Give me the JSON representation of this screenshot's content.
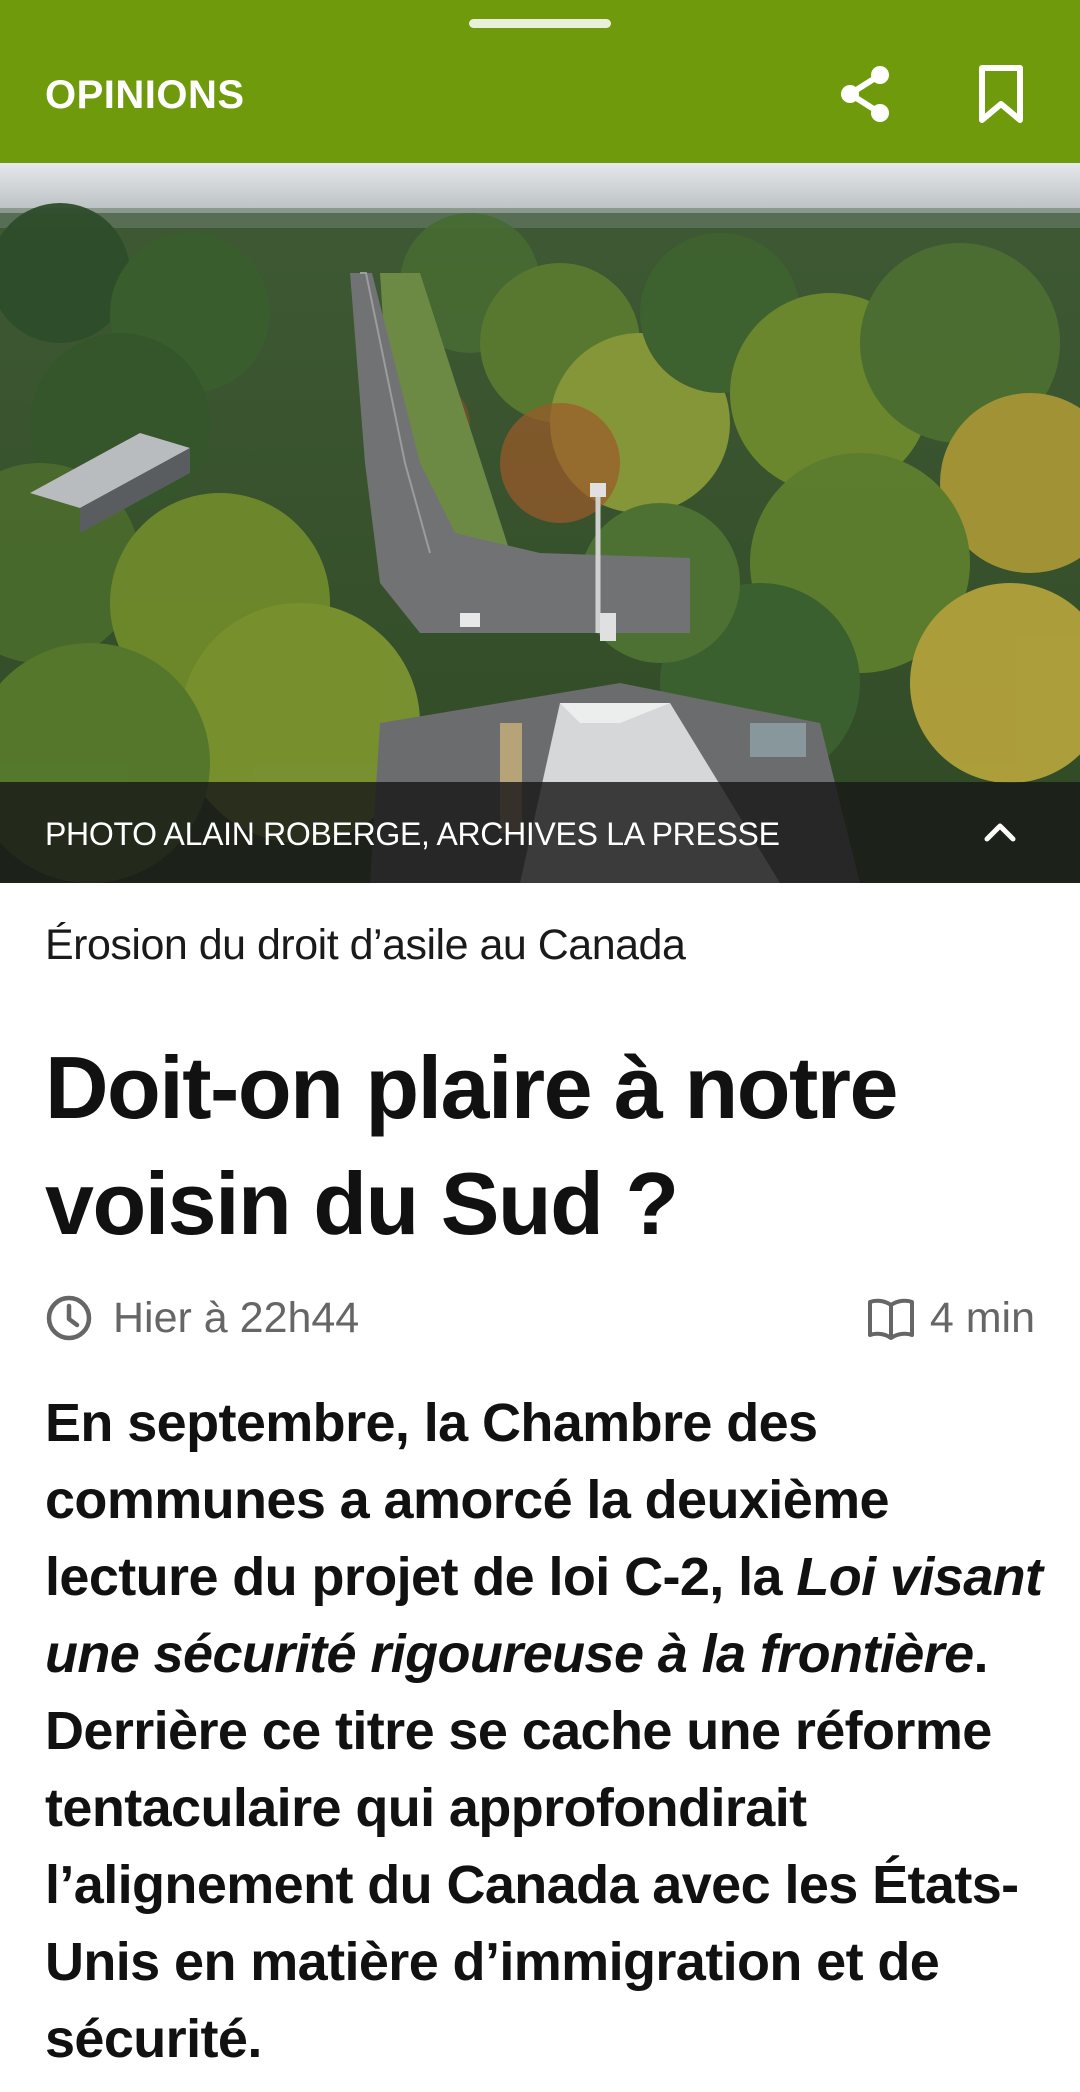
{
  "header": {
    "section": "OPINIONS",
    "share_icon": "share-icon",
    "bookmark_icon": "bookmark-icon",
    "background_color": "#6e9a0c"
  },
  "photo": {
    "credit": "PHOTO ALAIN ROBERGE, ARCHIVES LA PRESSE",
    "toggle_icon": "chevron-up-icon"
  },
  "article": {
    "kicker": "Érosion du droit d’asile au Canada",
    "title": "Doit-on plaire à notre voisin du Sud ?",
    "published": "Hier à 22h44",
    "reading_time": "4 min",
    "lede_part1": "En septembre, la Chambre des communes a amorcé la deuxième lecture du projet de loi C-2, la ",
    "lede_italic": "Loi visant une sécurité rigoureuse à la frontière",
    "lede_part2": ". Derrière ce titre se cache une réforme tentaculaire qui approfondirait l’alignement du Canada avec les États-Unis en matière d’immigration et de sécurité."
  }
}
